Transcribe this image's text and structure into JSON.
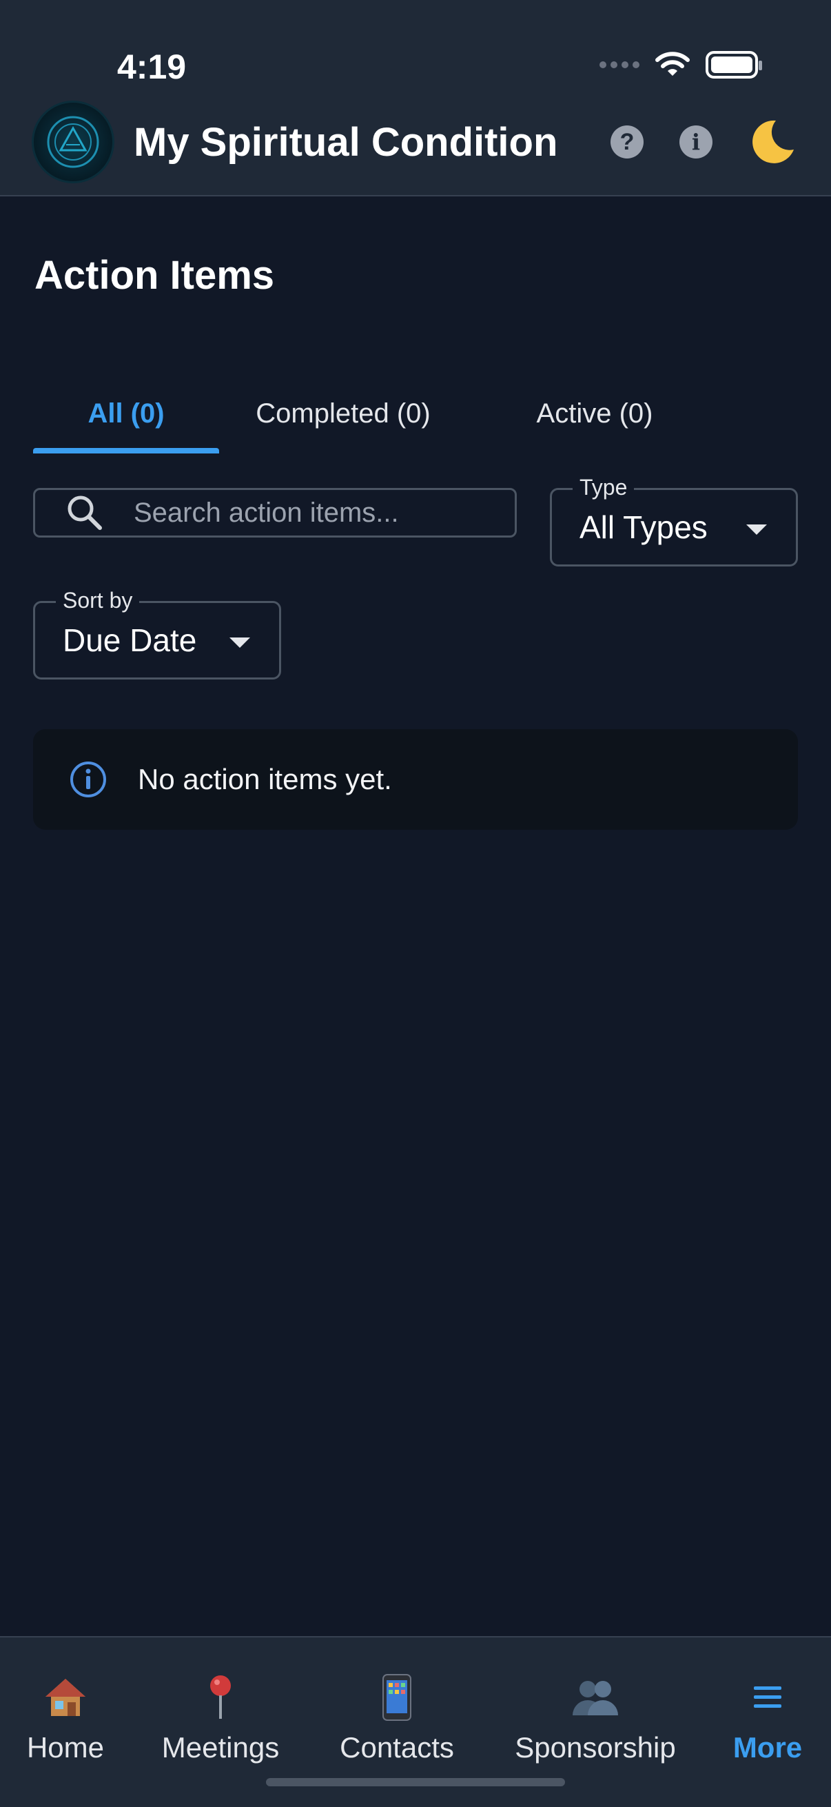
{
  "status_bar": {
    "time": "4:19"
  },
  "header": {
    "app_title": "My Spiritual Condition",
    "help_glyph": "?",
    "info_glyph": "i",
    "icons": [
      "help-icon",
      "info-icon",
      "moon-icon"
    ]
  },
  "page": {
    "title": "Action Items"
  },
  "tabs": [
    {
      "label": "All (0)",
      "active": true
    },
    {
      "label": "Completed (0)",
      "active": false
    },
    {
      "label": "Active (0)",
      "active": false
    }
  ],
  "search": {
    "placeholder": "Search action items...",
    "value": ""
  },
  "type_filter": {
    "label": "Type",
    "value": "All Types"
  },
  "sort_filter": {
    "label": "Sort by",
    "value": "Due Date"
  },
  "empty_state": {
    "message": "No action items yet."
  },
  "bottom_nav": [
    {
      "label": "Home",
      "icon": "house-icon"
    },
    {
      "label": "Meetings",
      "icon": "pushpin-icon"
    },
    {
      "label": "Contacts",
      "icon": "phone-icon"
    },
    {
      "label": "Sponsorship",
      "icon": "people-icon"
    },
    {
      "label": "More",
      "icon": "menu-icon",
      "active": true
    }
  ],
  "colors": {
    "background": "#111827",
    "surface": "#1f2937",
    "accent": "#3b9ef0",
    "border": "#4b5563"
  }
}
